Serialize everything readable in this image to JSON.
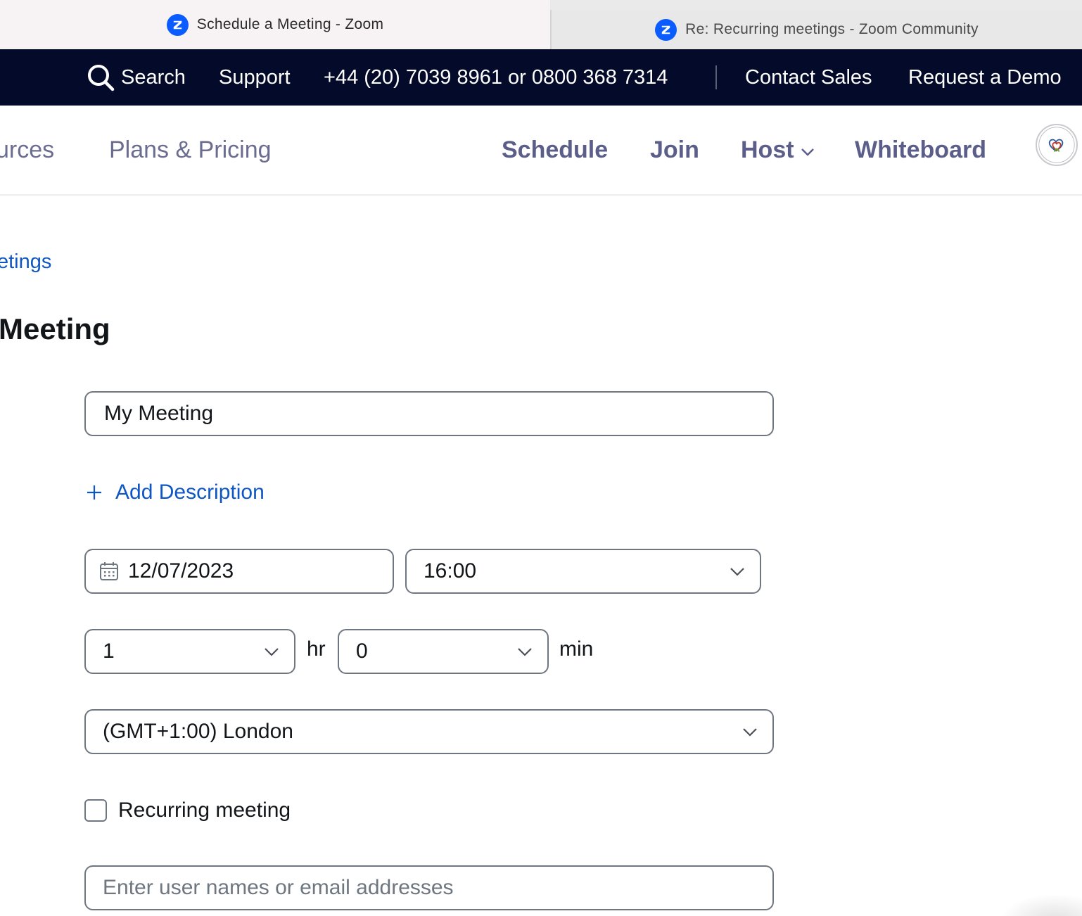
{
  "browser": {
    "tabs": [
      {
        "title": "Schedule a Meeting - Zoom",
        "active": true
      },
      {
        "title": "Re: Recurring meetings - Zoom Community",
        "active": false
      }
    ]
  },
  "topbar": {
    "search_label": "Search",
    "support_label": "Support",
    "phone": "+44 (20) 7039 8961 or 0800 368 7314",
    "contact_sales_label": "Contact Sales",
    "request_demo_label": "Request a Demo"
  },
  "navbar": {
    "resources_label": "urces",
    "plans_label": "Plans & Pricing",
    "schedule_label": "Schedule",
    "join_label": "Join",
    "host_label": "Host",
    "whiteboard_label": "Whiteboard"
  },
  "breadcrumb": "etings",
  "page_title": "Meeting",
  "form": {
    "topic_value": "My Meeting",
    "add_description_label": "Add Description",
    "date_value": "12/07/2023",
    "time_value": "16:00",
    "duration_hours": "1",
    "hours_unit": "hr",
    "duration_minutes": "0",
    "minutes_unit": "min",
    "timezone_value": "(GMT+1:00) London",
    "recurring_label": "Recurring meeting",
    "recurring_checked": false,
    "invitees_placeholder": "Enter user names or email addresses"
  },
  "colors": {
    "topbar_bg": "#040a29",
    "nav_text": "#5c5e8a",
    "link_blue": "#0e56c4",
    "zoom_blue": "#0b5cff"
  }
}
